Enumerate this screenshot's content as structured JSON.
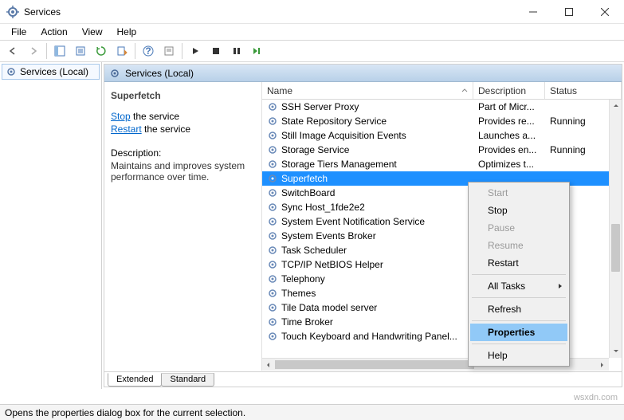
{
  "window": {
    "title": "Services"
  },
  "menu": {
    "file": "File",
    "action": "Action",
    "view": "View",
    "help": "Help"
  },
  "leftnav": {
    "label": "Services (Local)"
  },
  "header": {
    "label": "Services (Local)"
  },
  "detail": {
    "name": "Superfetch",
    "stop_link": "Stop",
    "stop_text": " the service",
    "restart_link": "Restart",
    "restart_text": " the service",
    "desc_label": "Description:",
    "desc_text": "Maintains and improves system performance over time."
  },
  "columns": {
    "name": "Name",
    "description": "Description",
    "status": "Status"
  },
  "services": [
    {
      "name": "SSH Server Proxy",
      "desc": "Part of Micr...",
      "status": ""
    },
    {
      "name": "State Repository Service",
      "desc": "Provides re...",
      "status": "Running"
    },
    {
      "name": "Still Image Acquisition Events",
      "desc": "Launches a...",
      "status": ""
    },
    {
      "name": "Storage Service",
      "desc": "Provides en...",
      "status": "Running"
    },
    {
      "name": "Storage Tiers Management",
      "desc": "Optimizes t...",
      "status": ""
    },
    {
      "name": "Superfetch",
      "desc": "",
      "status": "nning"
    },
    {
      "name": "SwitchBoard",
      "desc": "",
      "status": ""
    },
    {
      "name": "Sync Host_1fde2e2",
      "desc": "",
      "status": "nning"
    },
    {
      "name": "System Event Notification Service",
      "desc": "",
      "status": "nning"
    },
    {
      "name": "System Events Broker",
      "desc": "",
      "status": "nning"
    },
    {
      "name": "Task Scheduler",
      "desc": "",
      "status": "nning"
    },
    {
      "name": "TCP/IP NetBIOS Helper",
      "desc": "",
      "status": "nning"
    },
    {
      "name": "Telephony",
      "desc": "",
      "status": "nning"
    },
    {
      "name": "Themes",
      "desc": "",
      "status": "nning"
    },
    {
      "name": "Tile Data model server",
      "desc": "",
      "status": "nning"
    },
    {
      "name": "Time Broker",
      "desc": "",
      "status": "nning"
    },
    {
      "name": "Touch Keyboard and Handwriting Panel...",
      "desc": "",
      "status": "nning"
    }
  ],
  "selected_index": 5,
  "covered_from_index": 5,
  "context_menu": {
    "start": "Start",
    "stop": "Stop",
    "pause": "Pause",
    "resume": "Resume",
    "restart": "Restart",
    "all_tasks": "All Tasks",
    "refresh": "Refresh",
    "properties": "Properties",
    "help": "Help"
  },
  "tabs": {
    "extended": "Extended",
    "standard": "Standard"
  },
  "statusbar": {
    "text": "Opens the properties dialog box for the current selection."
  },
  "watermark": "wsxdn.com"
}
